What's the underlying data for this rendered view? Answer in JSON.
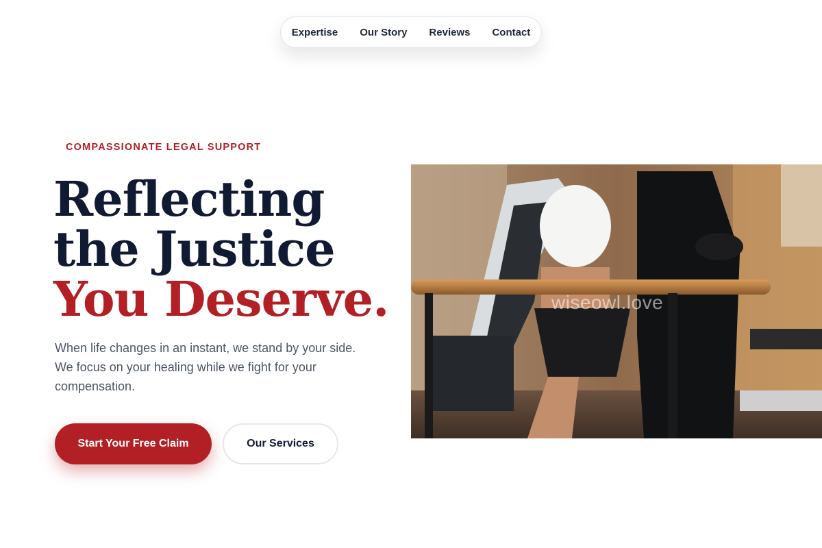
{
  "nav": {
    "items": [
      {
        "label": "Expertise"
      },
      {
        "label": "Our Story"
      },
      {
        "label": "Reviews"
      },
      {
        "label": "Contact"
      }
    ]
  },
  "hero": {
    "eyebrow": "COMPASSIONATE LEGAL SUPPORT",
    "headline": {
      "line1": "Reflecting",
      "line2": "the Justice",
      "line3_accent": "You Deserve."
    },
    "subtext": "When life changes in an instant, we stand by your side. We focus on your healing while we fight for your compensation.",
    "primary_cta": "Start Your Free Claim",
    "secondary_cta": "Our Services",
    "image": {
      "watermark": "wiseowl.love"
    }
  },
  "colors": {
    "accent": "#b21f24",
    "heading": "#111a33",
    "body_text": "#4b5563",
    "nav_text": "#1f2937"
  }
}
